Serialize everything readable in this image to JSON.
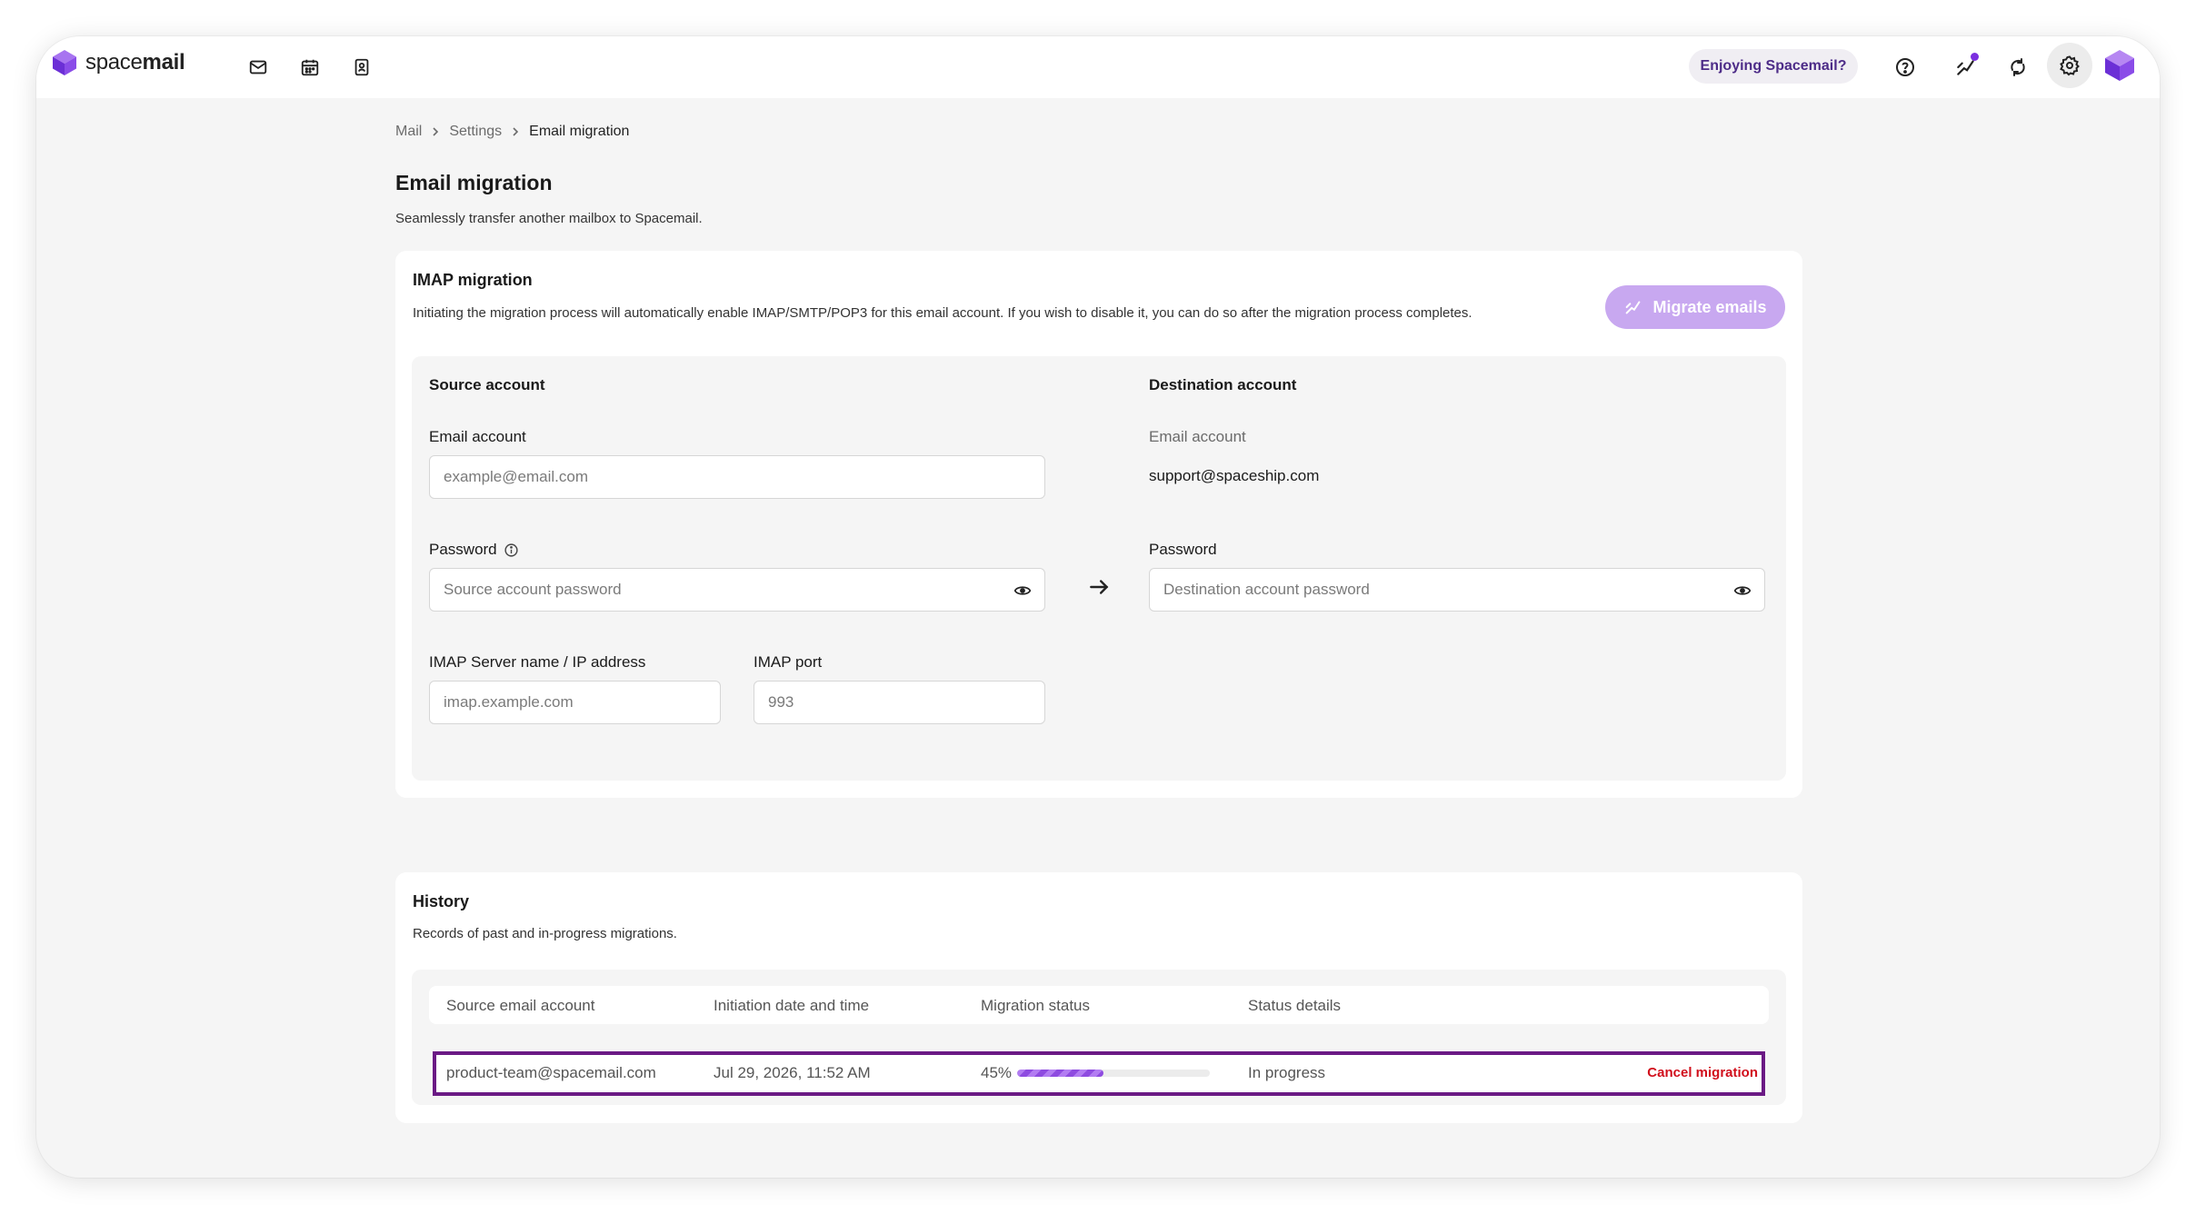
{
  "app": {
    "brand_prefix": "space",
    "brand_suffix": "mail",
    "brand_color": "#7b2fe0",
    "nav_icons": [
      "mail-icon",
      "calendar-icon",
      "contacts-icon"
    ],
    "enjoy_label": "Enjoying Spacemail?",
    "toolbar_icons": [
      "help-icon",
      "whats-new-icon",
      "sync-icon",
      "gear-icon"
    ]
  },
  "breadcrumb": {
    "items": [
      "Mail",
      "Settings",
      "Email migration"
    ]
  },
  "page": {
    "title": "Email migration",
    "subtitle": "Seamlessly transfer another mailbox to Spacemail."
  },
  "imap": {
    "title": "IMAP migration",
    "description": "Initiating the migration process will automatically enable IMAP/SMTP/POP3 for this email account. If you wish to disable it, you can do so after the migration process completes.",
    "migrate_button": "Migrate emails",
    "source": {
      "title": "Source account",
      "email_label": "Email account",
      "email_placeholder": "example@email.com",
      "password_label": "Password",
      "password_placeholder": "Source account password",
      "server_label": "IMAP Server name / IP address",
      "server_placeholder": "imap.example.com",
      "port_label": "IMAP port",
      "port_value": "993"
    },
    "destination": {
      "title": "Destination account",
      "email_label": "Email account",
      "email_value": "support@spaceship.com",
      "password_label": "Password",
      "password_placeholder": "Destination account password"
    }
  },
  "history": {
    "title": "History",
    "subtitle": "Records of past and in-progress migrations.",
    "columns": [
      "Source email account",
      "Initiation date and time",
      "Migration status",
      "Status details"
    ],
    "rows": [
      {
        "source": "product-team@spacemail.com",
        "initiated": "Jul 29, 2026, 11:52 AM",
        "progress_label": "45%",
        "progress": 0.45,
        "details": "In progress",
        "action": "Cancel migration"
      }
    ]
  }
}
